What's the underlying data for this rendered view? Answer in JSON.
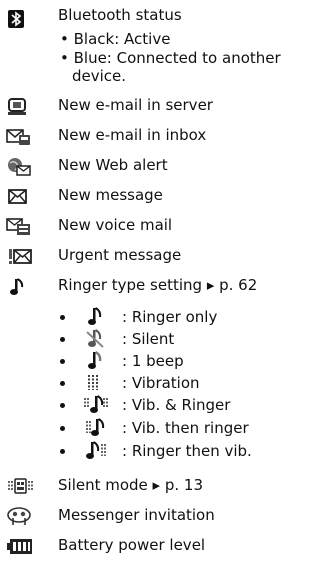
{
  "bluetooth": {
    "label": "Bluetooth status",
    "bullets": [
      "• Black: Active",
      "• Blue: Connected to another",
      "device."
    ]
  },
  "items": [
    {
      "icon": "email-server-icon",
      "label": "New e-mail in server"
    },
    {
      "icon": "email-inbox-icon",
      "label": "New e-mail in inbox"
    },
    {
      "icon": "web-alert-icon",
      "label": "New Web alert"
    },
    {
      "icon": "envelope-icon",
      "label": "New message"
    },
    {
      "icon": "voice-mail-icon",
      "label": "New voice mail"
    },
    {
      "icon": "urgent-message-icon",
      "label": "Urgent message"
    },
    {
      "icon": "music-note-icon",
      "label": "Ringer type setting ▸ p. 62"
    }
  ],
  "ringer_types": [
    {
      "icon": "ringer-only-icon",
      "label": ": Ringer only"
    },
    {
      "icon": "silent-icon",
      "label": ": Silent"
    },
    {
      "icon": "one-beep-icon",
      "label": ": 1 beep"
    },
    {
      "icon": "vibration-icon",
      "label": ": Vibration"
    },
    {
      "icon": "vib-and-ringer-icon",
      "label": ": Vib. & Ringer"
    },
    {
      "icon": "vib-then-ringer-icon",
      "label": ": Vib. then ringer"
    },
    {
      "icon": "ringer-then-vib-icon",
      "label": ": Ringer then vib."
    }
  ],
  "bottom_items": [
    {
      "icon": "silent-mode-icon",
      "label": "Silent mode ▸ p. 13"
    },
    {
      "icon": "messenger-icon",
      "label": "Messenger invitation"
    },
    {
      "icon": "battery-icon",
      "label": "Battery power level"
    }
  ]
}
